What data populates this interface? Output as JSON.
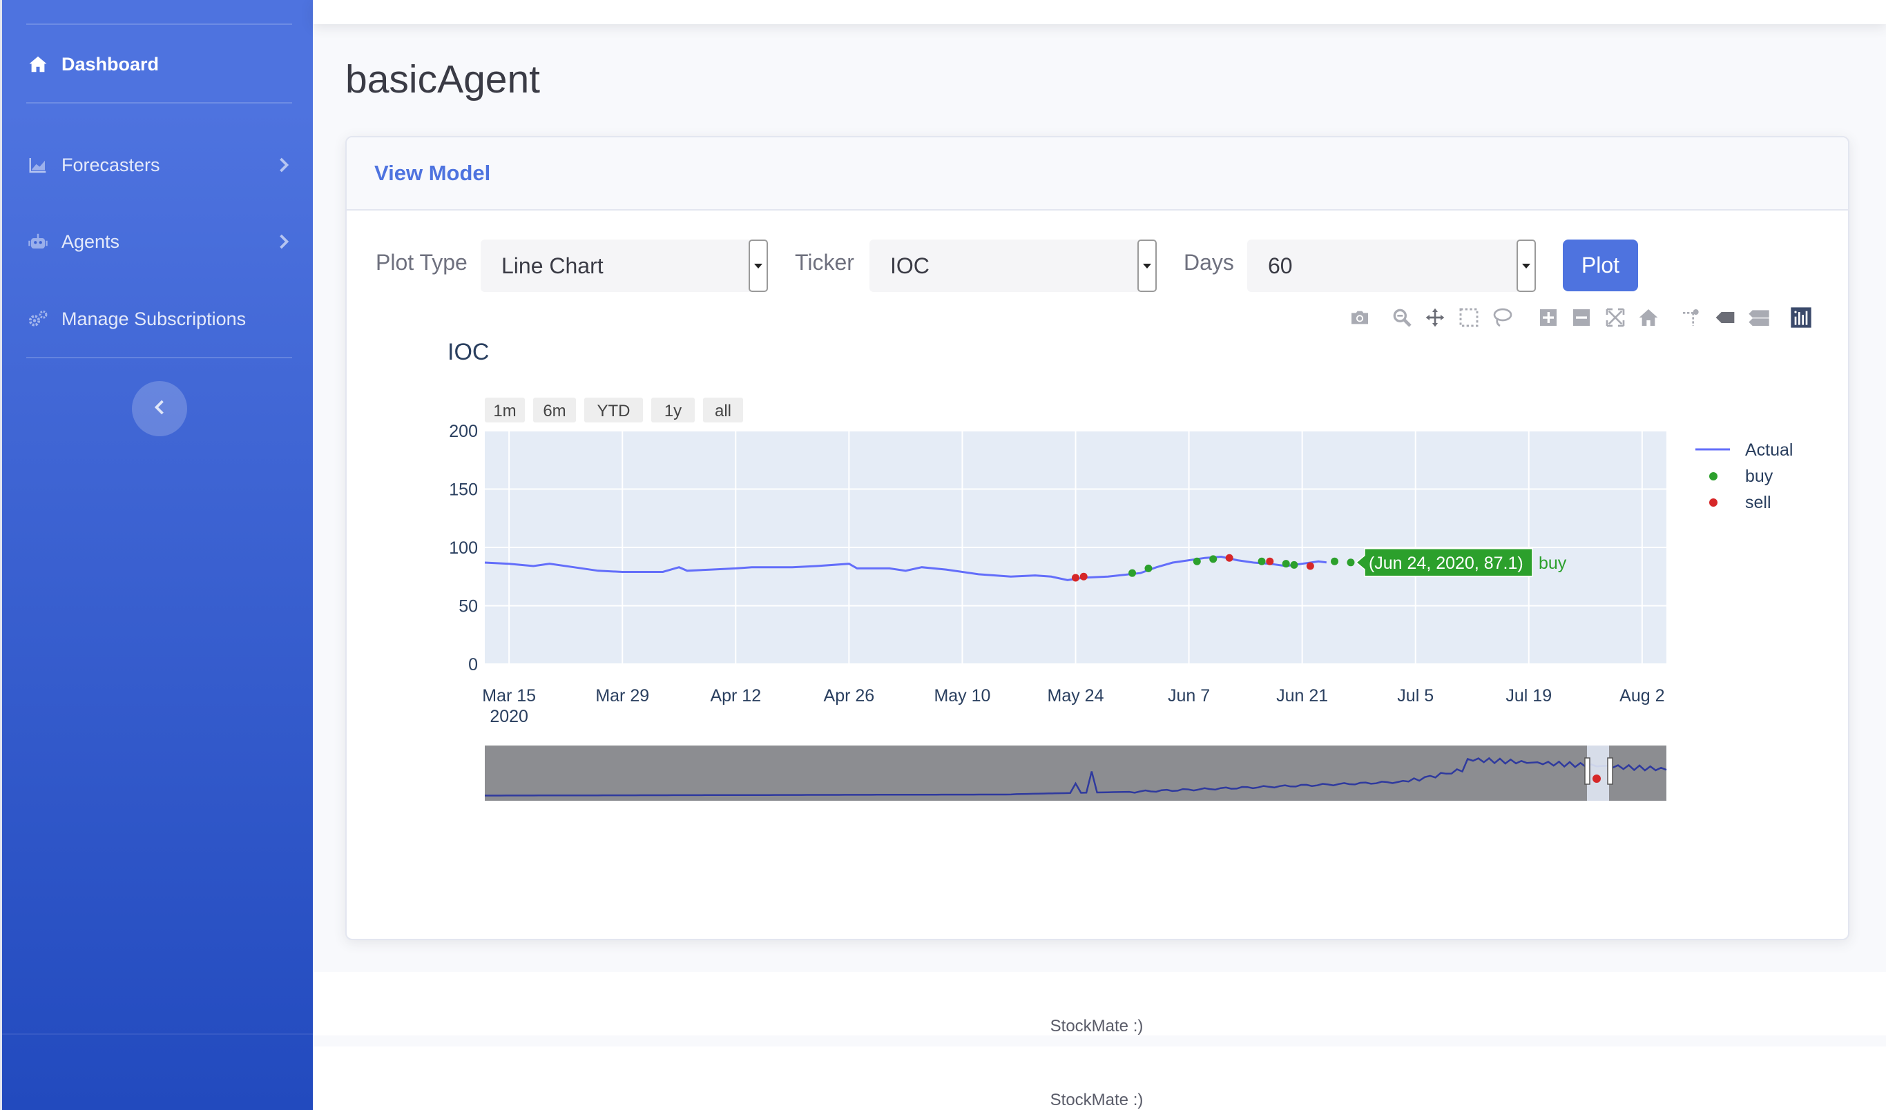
{
  "sidebar": {
    "items": [
      {
        "label": "Dashboard",
        "icon": "home-icon"
      },
      {
        "label": "Forecasters",
        "icon": "chart-area-icon"
      },
      {
        "label": "Agents",
        "icon": "robot-icon"
      },
      {
        "label": "Manage Subscriptions",
        "icon": "cogs-icon"
      }
    ],
    "toggle_icon": "chevron-left-icon"
  },
  "page": {
    "title": "basicAgent"
  },
  "card": {
    "title": "View Model",
    "controls": {
      "plot_type_label": "Plot Type",
      "plot_type_value": "Line Chart",
      "ticker_label": "Ticker",
      "ticker_value": "IOC",
      "days_label": "Days",
      "days_value": "60",
      "plot_button": "Plot"
    }
  },
  "modebar": [
    "camera-icon",
    "zoom-icon",
    "pan-icon",
    "box-select-icon",
    "lasso-select-icon",
    "zoom-in-icon",
    "zoom-out-icon",
    "autoscale-icon",
    "reset-axes-icon",
    "spike-lines-icon",
    "hover-closest-icon",
    "hover-compare-icon",
    "plotly-logo-icon"
  ],
  "chart_data": {
    "type": "line",
    "title": "IOC",
    "range_buttons": [
      "1m",
      "6m",
      "YTD",
      "1y",
      "all"
    ],
    "x_ticks": [
      "Mar 15",
      "Mar 29",
      "Apr 12",
      "Apr 26",
      "May 10",
      "May 24",
      "Jun 7",
      "Jun 21",
      "Jul 5",
      "Jul 19",
      "Aug 2"
    ],
    "x_tick_year": "2020",
    "y_ticks": [
      0,
      50,
      100,
      150,
      200
    ],
    "ylim": [
      0,
      200
    ],
    "xlim": [
      "2020-03-12",
      "2020-08-05"
    ],
    "grid": true,
    "legend_position": "right",
    "colors": {
      "actual": "#636efa",
      "buy": "#2ca02c",
      "sell": "#d62728",
      "plot_bg": "#e5ecf6",
      "rangeslider_bg": "#8c8d91"
    },
    "series": [
      {
        "name": "Actual",
        "mode": "line",
        "points": [
          [
            "2020-03-12",
            87
          ],
          [
            "2020-03-15",
            86
          ],
          [
            "2020-03-18",
            84
          ],
          [
            "2020-03-20",
            86
          ],
          [
            "2020-03-23",
            83
          ],
          [
            "2020-03-26",
            80
          ],
          [
            "2020-03-29",
            79
          ],
          [
            "2020-04-01",
            79
          ],
          [
            "2020-04-03",
            79
          ],
          [
            "2020-04-05",
            83
          ],
          [
            "2020-04-06",
            80
          ],
          [
            "2020-04-09",
            81
          ],
          [
            "2020-04-12",
            82
          ],
          [
            "2020-04-14",
            83
          ],
          [
            "2020-04-19",
            83
          ],
          [
            "2020-04-22",
            84
          ],
          [
            "2020-04-26",
            86
          ],
          [
            "2020-04-27",
            82
          ],
          [
            "2020-05-01",
            82
          ],
          [
            "2020-05-03",
            80
          ],
          [
            "2020-05-05",
            83
          ],
          [
            "2020-05-08",
            81
          ],
          [
            "2020-05-12",
            77
          ],
          [
            "2020-05-16",
            75
          ],
          [
            "2020-05-19",
            76
          ],
          [
            "2020-05-21",
            75
          ],
          [
            "2020-05-23",
            72
          ],
          [
            "2020-05-25",
            74
          ],
          [
            "2020-05-28",
            75
          ],
          [
            "2020-06-01",
            78
          ],
          [
            "2020-06-03",
            83
          ],
          [
            "2020-06-05",
            87
          ],
          [
            "2020-06-07",
            89
          ],
          [
            "2020-06-09",
            91
          ],
          [
            "2020-06-11",
            92
          ],
          [
            "2020-06-13",
            89
          ],
          [
            "2020-06-15",
            87
          ],
          [
            "2020-06-17",
            86
          ],
          [
            "2020-06-19",
            84
          ],
          [
            "2020-06-21",
            86
          ],
          [
            "2020-06-23",
            88
          ],
          [
            "2020-06-24",
            87.1
          ]
        ]
      },
      {
        "name": "buy",
        "mode": "markers",
        "points": [
          [
            "2020-05-31",
            78
          ],
          [
            "2020-06-02",
            82
          ],
          [
            "2020-06-08",
            88
          ],
          [
            "2020-06-10",
            90
          ],
          [
            "2020-06-16",
            88
          ],
          [
            "2020-06-19",
            86
          ],
          [
            "2020-06-20",
            85
          ],
          [
            "2020-06-25",
            88
          ],
          [
            "2020-06-27",
            87.1
          ]
        ]
      },
      {
        "name": "sell",
        "mode": "markers",
        "points": [
          [
            "2020-05-24",
            74
          ],
          [
            "2020-05-25",
            75
          ],
          [
            "2020-06-12",
            91
          ],
          [
            "2020-06-17",
            88
          ],
          [
            "2020-06-22",
            84
          ]
        ]
      }
    ],
    "hover": {
      "text": "(Jun 24, 2020, 87.1)",
      "series": "buy",
      "x": "2020-06-27",
      "y": 87.1
    }
  },
  "footer": {
    "text": "StockMate :)"
  }
}
